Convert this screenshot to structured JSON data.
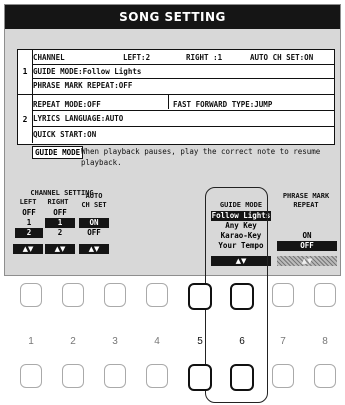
{
  "title": "SONG SETTING",
  "tabs": [
    {
      "number": "1"
    },
    {
      "number": "2"
    }
  ],
  "rows": {
    "channel": "CHANNEL",
    "left": "LEFT:2",
    "right": "RIGHT :1",
    "auto": "AUTO CH SET:ON",
    "guide_mode": "GUIDE MODE:Follow Lights",
    "phrase_mark": "PHRASE MARK REPEAT:OFF",
    "repeat_mode": "REPEAT MODE:OFF",
    "fast_forward": "FAST FORWARD TYPE:JUMP",
    "lyrics": "LYRICS LANGUAGE:AUTO",
    "quick_start": "QUICK START:ON"
  },
  "help": {
    "label": "GUIDE MODE",
    "text": "When playback pauses, play the correct note to resume playback."
  },
  "channel_setting": {
    "title": "CHANNEL SETTING",
    "left_label": "LEFT",
    "right_label": "RIGHT",
    "auto_label": "AUTO",
    "auto_label2": "CH SET",
    "left_values": [
      "OFF",
      "1",
      "2"
    ],
    "left_selected": "2",
    "right_values": [
      "OFF",
      "1",
      "2"
    ],
    "right_selected": "1",
    "auto_values": [
      "ON",
      "OFF"
    ],
    "auto_selected": "ON",
    "arrows": "▲▼"
  },
  "guide_mode": {
    "title": "GUIDE MODE",
    "options": [
      "Follow Lights",
      "Any Key",
      "Karao-Key",
      "Your Tempo"
    ],
    "selected": "Follow Lights",
    "arrows": "▲▼"
  },
  "phrase_mark": {
    "title": "PHRASE MARK",
    "title2": "REPEAT",
    "options": [
      "ON",
      "OFF"
    ],
    "selected": "OFF",
    "arrows": "▲▼"
  },
  "panel_buttons": {
    "numbers": [
      "1",
      "2",
      "3",
      "4",
      "5",
      "6",
      "7",
      "8"
    ],
    "active": [
      "5",
      "6"
    ]
  }
}
